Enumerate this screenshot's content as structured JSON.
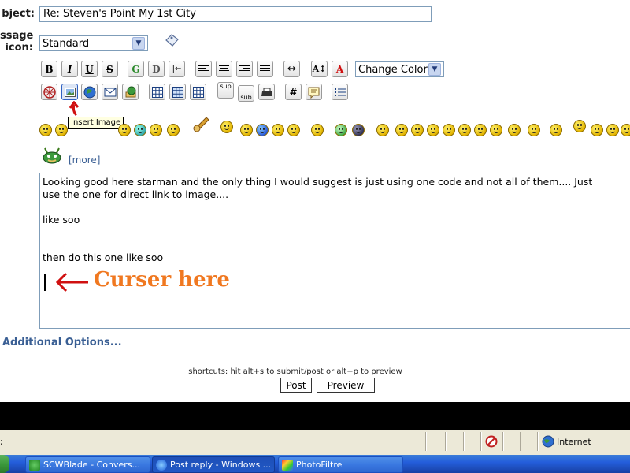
{
  "form": {
    "subject_label": "bject:",
    "subject_value": "Re: Steven's Point My 1st City",
    "message_icon_label_line1": "ssage",
    "message_icon_label_line2": "icon:",
    "message_icon_value": "Standard"
  },
  "toolbar": {
    "row1": [
      {
        "name": "bold-button",
        "label": "B"
      },
      {
        "name": "italic-button",
        "label": "I"
      },
      {
        "name": "underline-button",
        "label": "U"
      },
      {
        "name": "strikethrough-button",
        "label": "S"
      },
      {
        "name": "glow-button",
        "label": "G"
      },
      {
        "name": "shadow-button",
        "label": "D"
      },
      {
        "name": "indent-button",
        "label": "|←"
      },
      {
        "name": "align-left-button",
        "label": ""
      },
      {
        "name": "align-center-button",
        "label": ""
      },
      {
        "name": "align-right-button",
        "label": ""
      },
      {
        "name": "align-justify-button",
        "label": ""
      },
      {
        "name": "horizontal-rule-button",
        "label": "↔"
      },
      {
        "name": "font-size-button",
        "label": "A↕"
      },
      {
        "name": "font-color-button",
        "label": "A"
      }
    ],
    "change_color_label": "Change Color",
    "row2": [
      {
        "name": "flash-button",
        "label": ""
      },
      {
        "name": "insert-image-button",
        "label": ""
      },
      {
        "name": "insert-link-button",
        "label": ""
      },
      {
        "name": "insert-email-button",
        "label": ""
      },
      {
        "name": "insert-ftp-button",
        "label": ""
      },
      {
        "name": "table-button",
        "label": ""
      },
      {
        "name": "table-row-button",
        "label": ""
      },
      {
        "name": "table-column-button",
        "label": ""
      },
      {
        "name": "superscript-button",
        "label": "sup"
      },
      {
        "name": "subscript-button",
        "label": "sub"
      },
      {
        "name": "teletype-button",
        "label": ""
      },
      {
        "name": "code-button",
        "label": "#"
      },
      {
        "name": "quote-button",
        "label": ""
      },
      {
        "name": "list-button",
        "label": ""
      }
    ],
    "tooltip": "Insert Image"
  },
  "smileys": {
    "more_label": "[more]"
  },
  "message": {
    "lines": [
      "Looking good here starman and the only thing I would suggest is just using one code and not all of them.... Just",
      "use the one for direct link to image....",
      "",
      "like soo",
      "",
      "",
      "then do this one like soo"
    ],
    "annotation": "Curser here"
  },
  "options": {
    "additional_options": "Additional Options..."
  },
  "actions": {
    "shortcuts": "shortcuts: hit alt+s to submit/post or alt+p to preview",
    "post": "Post",
    "preview": "Preview"
  },
  "statusbar": {
    "left_text": ";",
    "zone": "Internet"
  },
  "taskbar": {
    "tasks": [
      {
        "label": "SCWBlade - Convers..."
      },
      {
        "label": "Post reply - Windows ..."
      },
      {
        "label": "PhotoFiltre"
      }
    ]
  },
  "colors": {
    "annotation": "#f07820",
    "arrow": "#d01010",
    "link": "#3a5f94"
  }
}
